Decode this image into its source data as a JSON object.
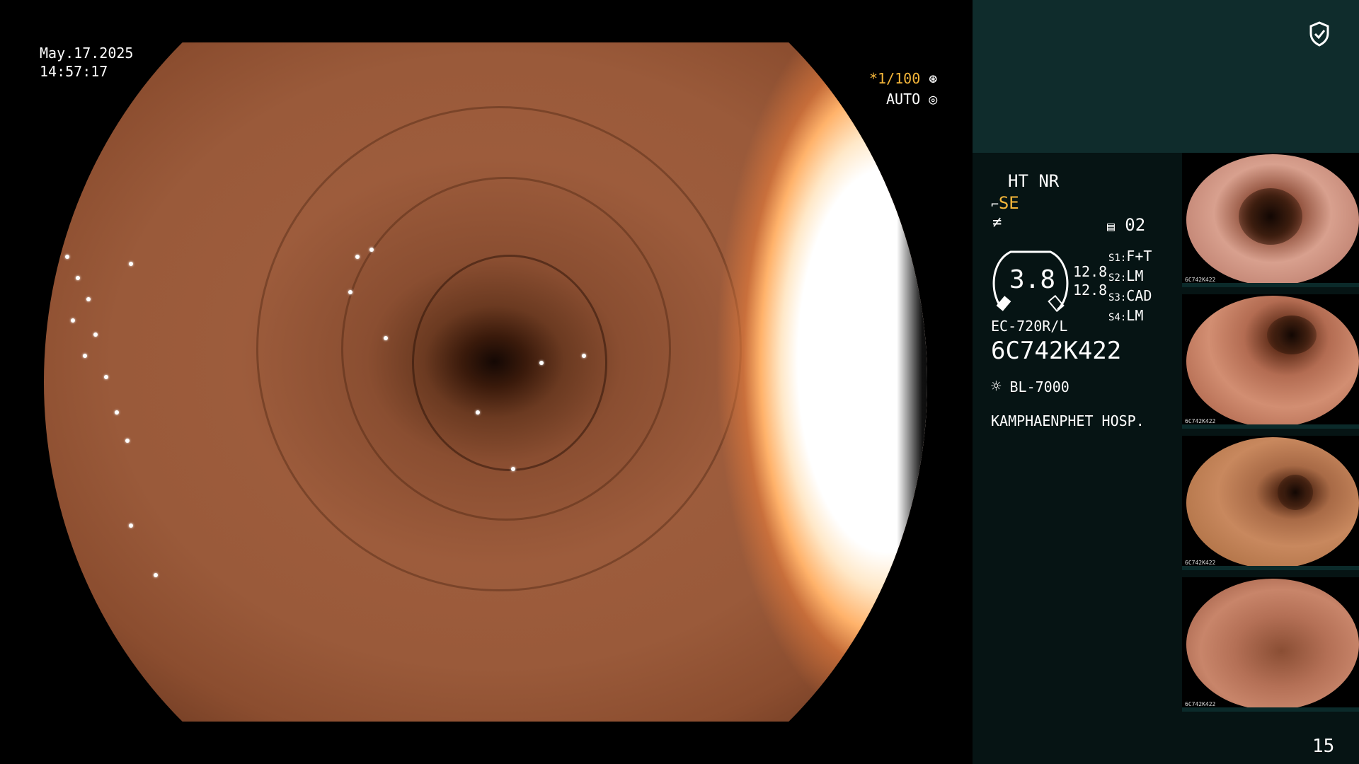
{
  "screen": {
    "date": "May.17.2025",
    "time": "14:57:17",
    "page_number": "15"
  },
  "osd": {
    "shutter": "*1/100",
    "iris": "AUTO",
    "shutter_icon": "aperture-icon",
    "iris_icon": "iris-icon"
  },
  "panel": {
    "ht_nr": "HT NR",
    "mode": "SE",
    "set_02": "02",
    "scope_value": "3.8",
    "val_top": "12.8",
    "val_bottom": "12.8",
    "s1_label": "S1",
    "s1_value": "F+T",
    "s2_label": "S2",
    "s2_value": "LM",
    "s3_label": "S3",
    "s3_value": "CAD",
    "s4_label": "S4",
    "s4_value": "LM",
    "scope_model": "EC-720R/L",
    "scope_serial": "6C742K422",
    "light_source": "BL-7000",
    "hospital": "KAMPHAENPHET HOSP.",
    "colors": {
      "panel_top": "#0f2c2c",
      "panel_main": "#061414",
      "accent_yellow": "#f5b63a"
    }
  },
  "thumbnails": [
    {
      "label": "6C742K422"
    },
    {
      "label": "6C742K422"
    },
    {
      "label": "6C742K422"
    },
    {
      "label": "6C742K422"
    }
  ]
}
